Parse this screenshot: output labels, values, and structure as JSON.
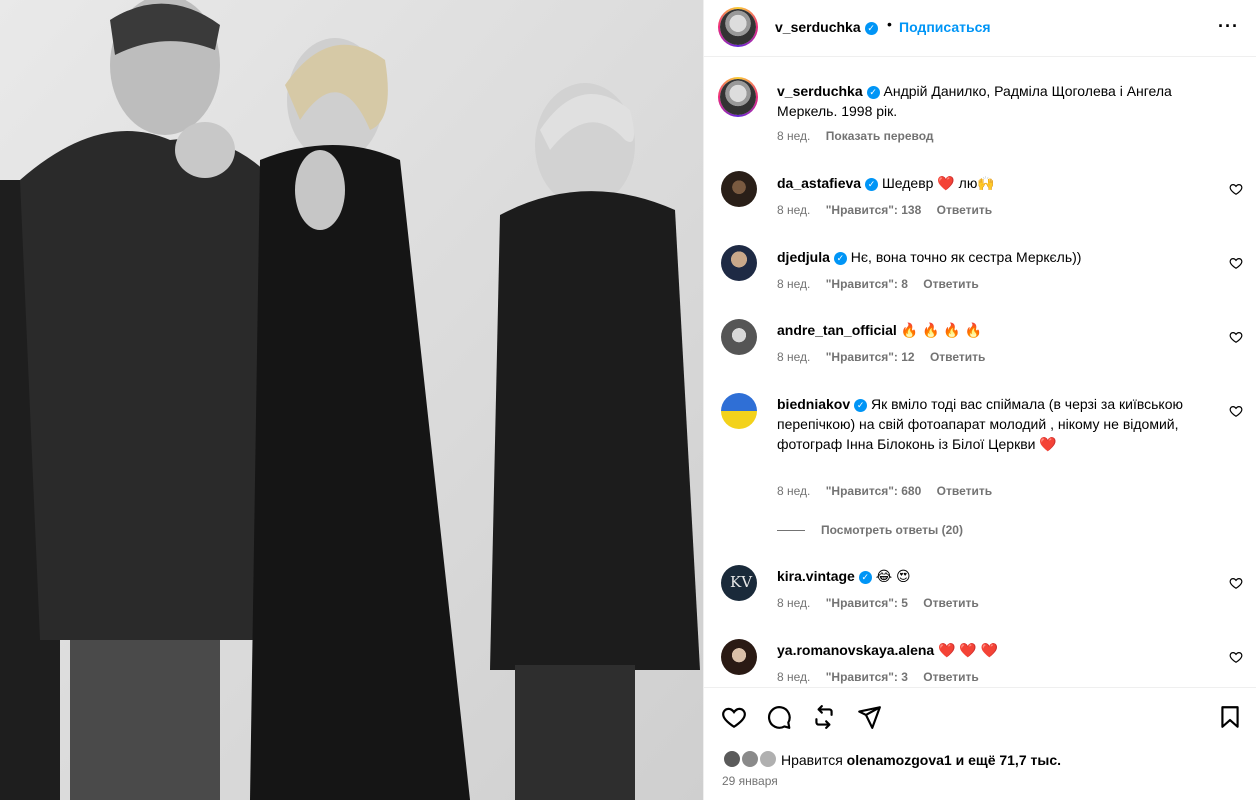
{
  "post": {
    "author": "v_serduchka",
    "follow_label": "Подписаться",
    "more_icon": "more-horizontal-icon",
    "dot": "•"
  },
  "caption": {
    "username": "v_serduchka",
    "text": "Андрій Данилко, Радміла Щоголева і Ангела Меркель. 1998 рік.",
    "time": "8 нед.",
    "translate_label": "Показать перевод"
  },
  "comments": [
    {
      "username": "da_astafieva",
      "verified": true,
      "text": "Шедевр ❤️  лю🙌",
      "time": "8 нед.",
      "likes": "\"Нравится\": 138",
      "reply": "Ответить"
    },
    {
      "username": "djedjula",
      "verified": true,
      "text": "Нє, вона точно як сестра Меркєль))",
      "time": "8 нед.",
      "likes": "\"Нравится\": 8",
      "reply": "Ответить"
    },
    {
      "username": "andre_tan_official",
      "verified": false,
      "text": "🔥 🔥 🔥 🔥",
      "time": "8 нед.",
      "likes": "\"Нравится\": 12",
      "reply": "Ответить"
    },
    {
      "username": "biedniakov",
      "verified": true,
      "text": "Як вміло тоді вас спіймала (в черзі за київською перепічкою) на свій фотоапарат молодий , нікому не відомий, фотограф Інна Білоконь із Білої Церкви ❤️",
      "time": "8 нед.",
      "likes": "\"Нравится\": 680",
      "reply": "Ответить",
      "view_replies": "Посмотреть ответы (20)"
    },
    {
      "username": "kira.vintage",
      "verified": true,
      "text": "😂 😍",
      "time": "8 нед.",
      "likes": "\"Нравится\": 5",
      "reply": "Ответить"
    },
    {
      "username": "ya.romanovskaya.alena",
      "verified": false,
      "text": "❤️ ❤️ ❤️",
      "time": "8 нед.",
      "likes": "\"Нравится\": 3",
      "reply": "Ответить"
    }
  ],
  "likes": {
    "prefix": "Нравится",
    "user": "olenamozgova1",
    "suffix": "и ещё 71,7 тыс.",
    "date": "29 января"
  },
  "colors": {
    "accent": "#0095f6",
    "muted": "#737373",
    "heart": "#e8345a"
  }
}
